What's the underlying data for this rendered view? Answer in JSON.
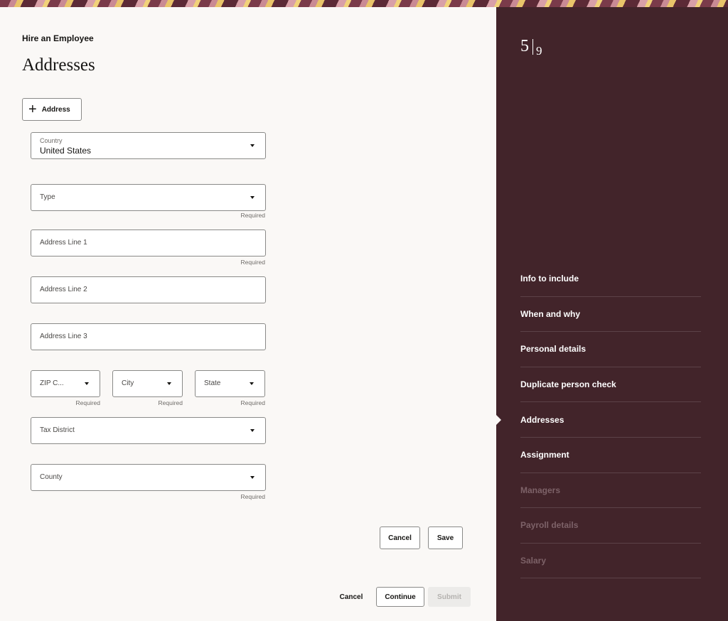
{
  "header": {
    "breadcrumb": "Hire an Employee",
    "title": "Addresses"
  },
  "toolbar": {
    "add_address_label": "Address"
  },
  "form": {
    "country": {
      "label": "Country",
      "value": "United States"
    },
    "type": {
      "label": "Type",
      "hint": "Required"
    },
    "address_line_1": {
      "label": "Address Line 1",
      "hint": "Required"
    },
    "address_line_2": {
      "label": "Address Line 2"
    },
    "address_line_3": {
      "label": "Address Line 3"
    },
    "zip_code": {
      "label": "ZIP C...",
      "hint": "Required"
    },
    "city": {
      "label": "City",
      "hint": "Required"
    },
    "state": {
      "label": "State",
      "hint": "Required"
    },
    "tax_district": {
      "label": "Tax District"
    },
    "county": {
      "label": "County",
      "hint": "Required"
    }
  },
  "form_actions": {
    "cancel_label": "Cancel",
    "save_label": "Save"
  },
  "footer": {
    "cancel_label": "Cancel",
    "continue_label": "Continue",
    "submit_label": "Submit"
  },
  "progress": {
    "current": "5",
    "total": "9"
  },
  "steps": [
    {
      "label": "Info to include",
      "state": "done"
    },
    {
      "label": "When and why",
      "state": "done"
    },
    {
      "label": "Personal details",
      "state": "done"
    },
    {
      "label": "Duplicate person check",
      "state": "done"
    },
    {
      "label": "Addresses",
      "state": "current"
    },
    {
      "label": "Assignment",
      "state": "available"
    },
    {
      "label": "Managers",
      "state": "disabled"
    },
    {
      "label": "Payroll details",
      "state": "disabled"
    },
    {
      "label": "Salary",
      "state": "disabled"
    }
  ],
  "colors": {
    "sidebar_bg": "#42242a",
    "page_bg": "#faf8f6",
    "dim_step": "#7d6268"
  },
  "icons": {
    "add": "plus-icon",
    "dropdown": "chevron-down-icon",
    "current_step": "pointer-arrow-icon"
  }
}
